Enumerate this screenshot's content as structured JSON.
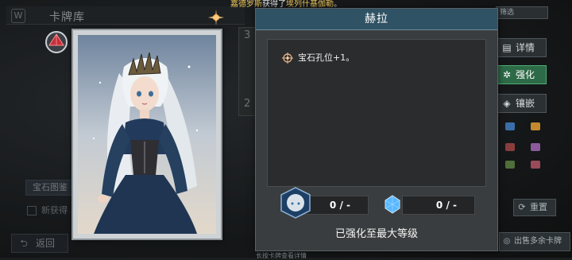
{
  "notice": {
    "name": "嘉德罗斯",
    "middle": "获得了",
    "item": "埃列什基伽勒",
    "end": "。"
  },
  "library": {
    "title": "卡牌库",
    "gem_menu": "宝石图鉴",
    "new_label": "新获得",
    "back_label": "返回"
  },
  "card": {
    "peek_top": "3",
    "peek_bottom": "2"
  },
  "modal": {
    "title": "赫拉",
    "bonus_text": "宝石孔位+1。",
    "stat_a_value": "0 / -",
    "stat_b_value": "0 / -",
    "status_text": "已强化至最大等级"
  },
  "right_panel": {
    "top_box": "筛选",
    "detail_label": "详情",
    "enhance_label": "强化",
    "inlay_label": "镶嵌",
    "reset_label": "重置",
    "sell_label": "出售多余卡牌"
  },
  "hint": "长按卡牌查看详情",
  "colors": {
    "active_button": "#2d6a47",
    "header": "#2f5264",
    "highlight": "#f0c85a",
    "crystal": "#58b7ff"
  },
  "icons": [
    "library-icon",
    "rarity-gem-icon",
    "spark-icon",
    "target-star-icon",
    "portrait-badge-icon",
    "crystal-icon",
    "detail-icon",
    "enhance-icon",
    "inlay-icon",
    "reset-icon",
    "sell-icon",
    "back-arrow-icon"
  ]
}
